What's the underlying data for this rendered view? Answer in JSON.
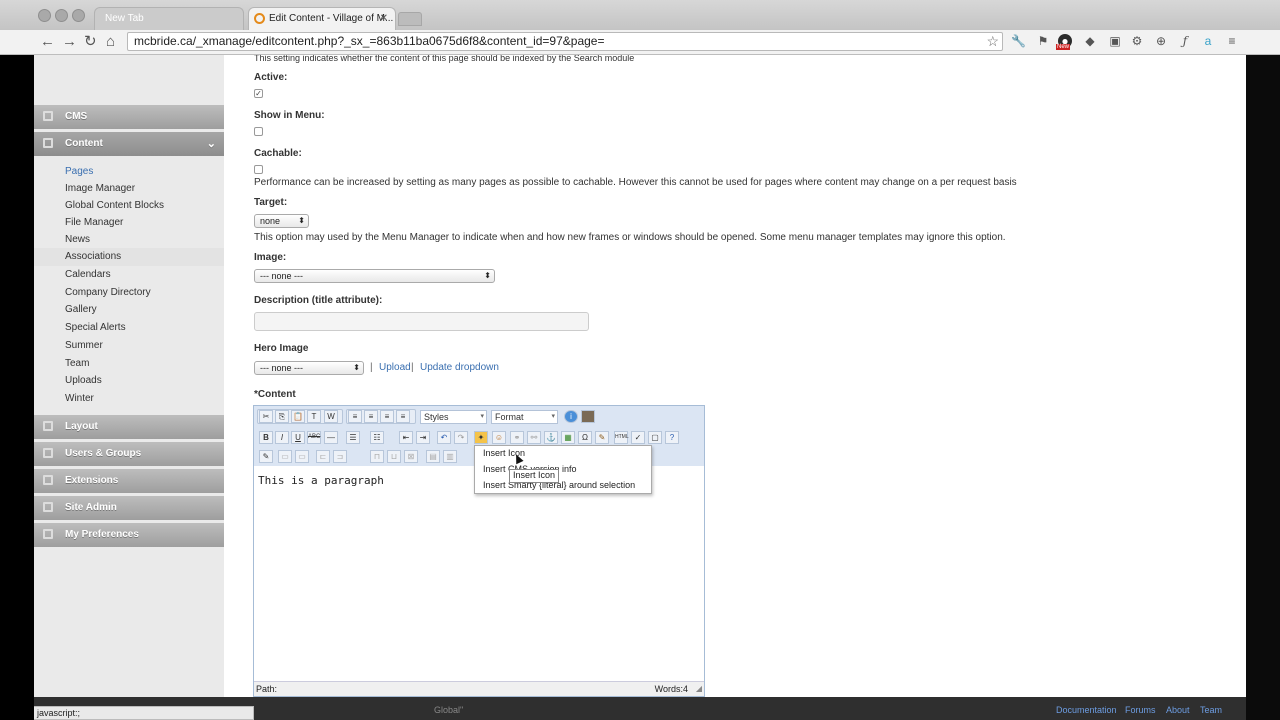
{
  "browser": {
    "tabs": [
      {
        "label": "New Tab"
      },
      {
        "label": "Edit Content - Village of M..."
      }
    ],
    "url": "mcbride.ca/_xmanage/editcontent.php?_sx_=863b11ba0675d6f8&content_id=97&page=",
    "new_badge": "New"
  },
  "sidebar": {
    "sections": [
      {
        "label": "CMS"
      },
      {
        "label": "Content"
      },
      {
        "label": "Layout"
      },
      {
        "label": "Users & Groups"
      },
      {
        "label": "Extensions"
      },
      {
        "label": "Site Admin"
      },
      {
        "label": "My Preferences"
      }
    ],
    "content_items": [
      "Pages",
      "Image Manager",
      "Global Content Blocks",
      "File Manager",
      "News",
      "Associations",
      "Calendars",
      "Company Directory",
      "Gallery",
      "Special Alerts",
      "Summer",
      "Team",
      "Uploads",
      "Winter"
    ]
  },
  "form": {
    "top_note": "This setting indicates whether the content of this page should be indexed by the Search module",
    "active_label": "Active:",
    "active_checked": true,
    "show_in_menu_label": "Show in Menu:",
    "cachable_label": "Cachable:",
    "cachable_note": "Performance can be increased by setting as many pages as possible to cachable. However this cannot be used for pages where content may change on a per request basis",
    "target_label": "Target:",
    "target_value": "none",
    "target_note": "This option may used by the Menu Manager to indicate when and how new frames or windows should be opened. Some menu manager templates may ignore this option.",
    "image_label": "Image:",
    "image_value": "--- none ---",
    "description_label": "Description (title attribute):",
    "hero_label": "Hero Image",
    "hero_value": "--- none ---",
    "hero_upload": "Upload",
    "hero_update": "Update dropdown",
    "separator": "|",
    "content_label": "*Content"
  },
  "editor": {
    "styles_select": "Styles",
    "format_select": "Format",
    "body_text": "This is a paragraph",
    "path_label": "Path:",
    "word_count": "Words:4",
    "menu_items": [
      "Insert Icon",
      "Insert CMS version info",
      "Insert Smarty {literal} around selection"
    ],
    "tooltip": "Insert Icon"
  },
  "footer": {
    "partial_text": "Global\"",
    "links": [
      "Documentation",
      "Forums",
      "About",
      "Team"
    ]
  },
  "status_bar": "javascript:;"
}
